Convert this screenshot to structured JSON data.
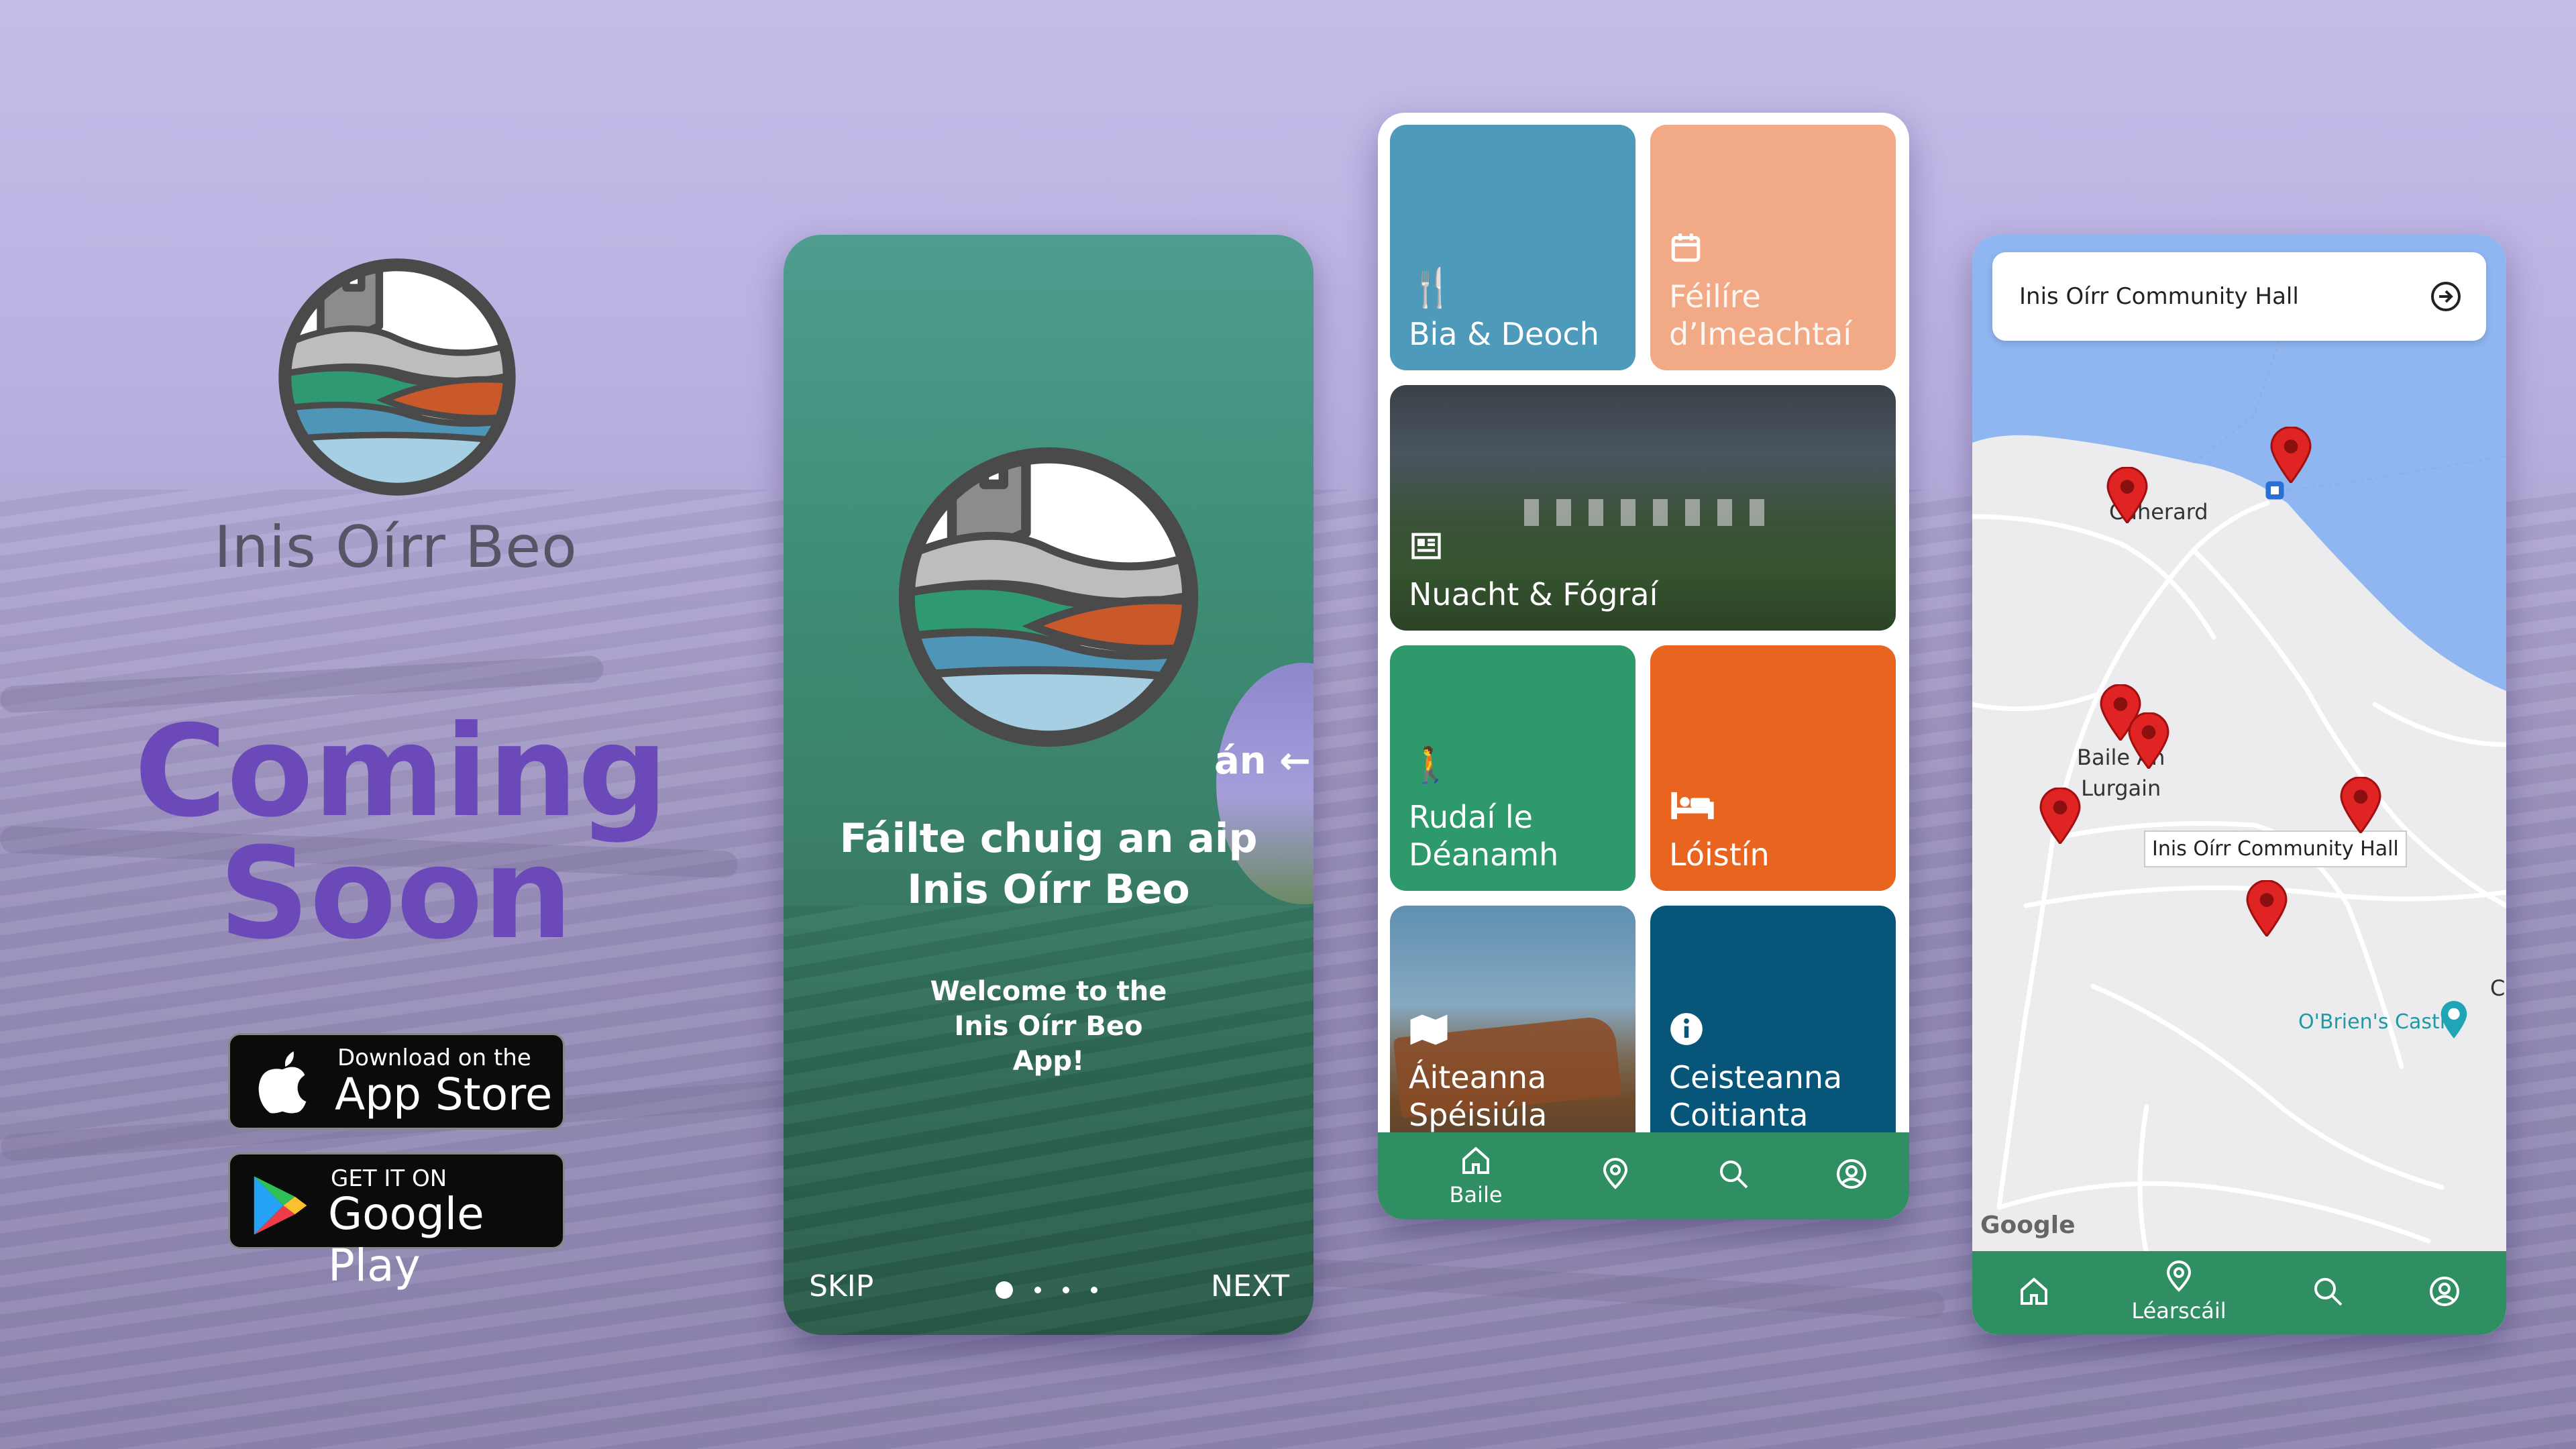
{
  "brand": {
    "name": "Inis Oírr Beo",
    "coming_soon_line1": "Coming",
    "coming_soon_line2": "Soon"
  },
  "stores": {
    "apple_small": "Download on the",
    "apple_big": "App Store",
    "google_small": "GET IT ON",
    "google_big": "Google Play"
  },
  "onboarding": {
    "peek_text": "án",
    "title_line1": "Fáilte chuig an aip",
    "title_line2": "Inis Oírr Beo",
    "subtitle_line1": "Welcome to the",
    "subtitle_line2": "Inis Oírr Beo",
    "subtitle_line3": "App!",
    "skip_label": "SKIP",
    "next_label": "NEXT",
    "page_count": 4,
    "current_page": 1
  },
  "home": {
    "tiles": [
      {
        "label": "Bia & Deoch",
        "icon": "cutlery-icon",
        "color": "#4e9aba"
      },
      {
        "label_line1": "Féilíre",
        "label_line2": "d’Imeachtaí",
        "icon": "calendar-icon",
        "color": "#f2a986"
      },
      {
        "label": "Nuacht & Fógraí",
        "icon": "news-icon"
      },
      {
        "label_line1": "Rudaí le",
        "label_line2": "Déanamh",
        "icon": "walking-icon",
        "color": "#2e9a6c"
      },
      {
        "label": "Lóistín",
        "icon": "bed-icon",
        "color": "#e8641f"
      },
      {
        "label_line1": "Áiteanna",
        "label_line2": "Spéisiúla",
        "icon": "map-icon"
      },
      {
        "label_line1": "Ceisteanna",
        "label_line2": "Coitianta",
        "icon": "info-icon",
        "color": "#07567a"
      }
    ],
    "nav": {
      "home": "Baile"
    }
  },
  "map": {
    "search_text": "Inis Oírr Community Hall",
    "labels": {
      "caherard": "Caherard",
      "baile_line1": "Baile An",
      "baile_line2": "Lurgain",
      "callout": "Inis Oírr Community Hall",
      "castle": "O'Brien's Castle",
      "edge": "C",
      "google": "Google"
    },
    "nav": {
      "map": "Léarscáil"
    }
  },
  "colors": {
    "accent_purple": "#6b49b8",
    "nav_green": "#2f8f63",
    "pin_red": "#e02424"
  }
}
